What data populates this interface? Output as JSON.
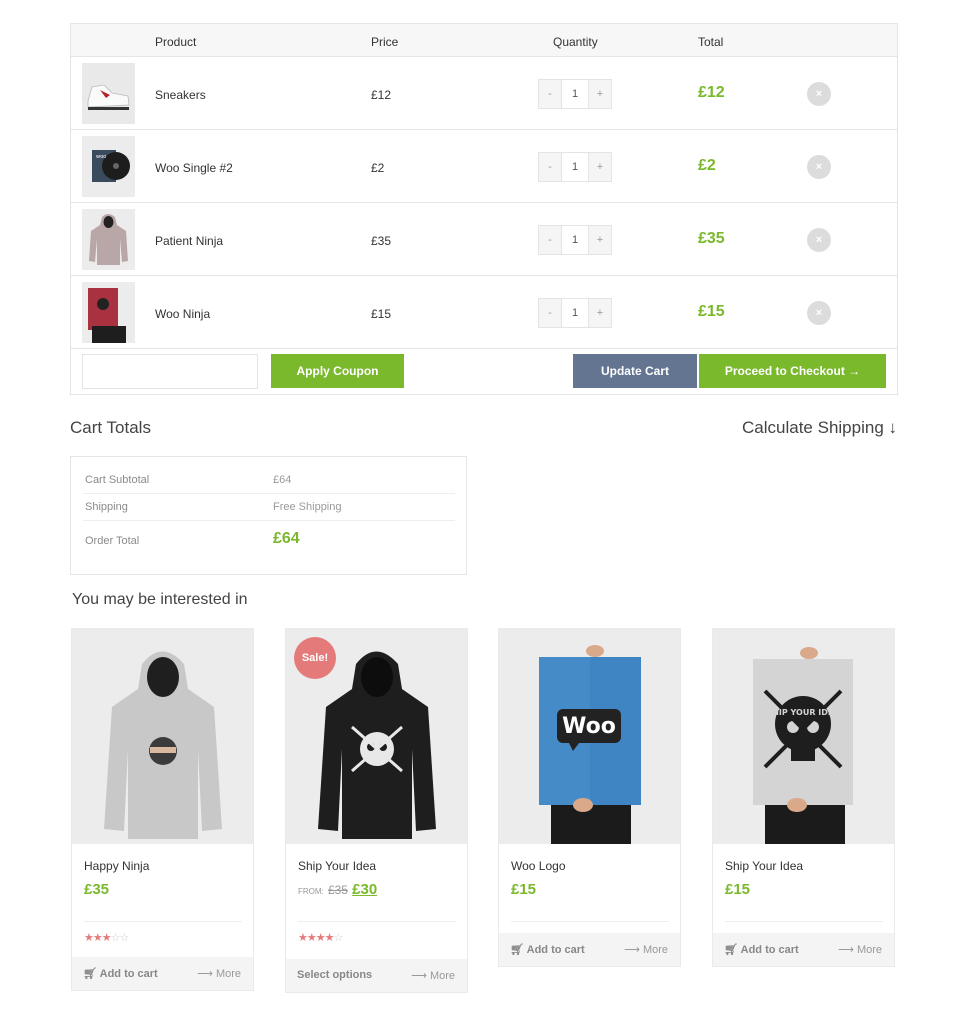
{
  "cart": {
    "headers": {
      "product": "Product",
      "price": "Price",
      "quantity": "Quantity",
      "total": "Total"
    },
    "items": [
      {
        "name": "Sneakers",
        "price": "£12",
        "qty": "1",
        "total": "£12",
        "icon": "sneakers-image"
      },
      {
        "name": "Woo Single #2",
        "price": "£2",
        "qty": "1",
        "total": "£2",
        "icon": "album-image"
      },
      {
        "name": "Patient Ninja",
        "price": "£35",
        "qty": "1",
        "total": "£35",
        "icon": "hoodie-image"
      },
      {
        "name": "Woo Ninja",
        "price": "£15",
        "qty": "1",
        "total": "£15",
        "icon": "poster-image"
      }
    ],
    "minus": "-",
    "plus": "+",
    "remove": "×",
    "coupon_placeholder": "",
    "apply_coupon": "Apply Coupon",
    "update_cart": "Update Cart",
    "checkout": "Proceed to Checkout →"
  },
  "totals": {
    "title": "Cart Totals",
    "calculate_shipping": "Calculate Shipping ↓",
    "subtotal_label": "Cart Subtotal",
    "subtotal_value": "£64",
    "shipping_label": "Shipping",
    "shipping_value": "Free Shipping",
    "order_total_label": "Order Total",
    "order_total_value": "£64"
  },
  "related": {
    "title": "You may be interested in",
    "products": [
      {
        "title": "Happy Ninja",
        "price": "£35",
        "rating": 3,
        "action": "Add to cart",
        "more": "More"
      },
      {
        "title": "Ship Your Idea",
        "from": "FROM:",
        "old_price": "£35",
        "price": "£30",
        "sale": "Sale!",
        "rating": 4,
        "action": "Select options",
        "more": "More"
      },
      {
        "title": "Woo Logo",
        "price": "£15",
        "action": "Add to cart",
        "more": "More",
        "poster_text": "Woo"
      },
      {
        "title": "Ship Your Idea",
        "price": "£15",
        "action": "Add to cart",
        "more": "More",
        "poster_text": "SHIP YOUR IDEA"
      }
    ]
  },
  "colors": {
    "accent": "#7ab82c",
    "update_button": "#637591",
    "sale_badge": "#e57a7a",
    "star": "#e57a7a"
  }
}
